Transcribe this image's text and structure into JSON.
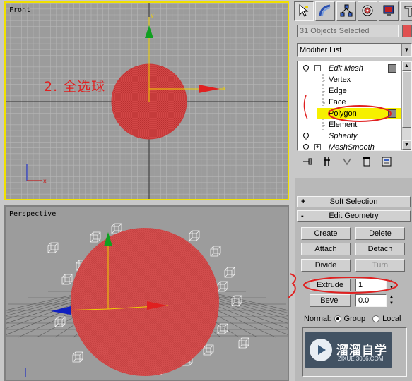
{
  "viewports": {
    "front": {
      "label": "Front"
    },
    "perspective": {
      "label": "Perspective"
    }
  },
  "annotation": {
    "step_text": "2. 全选球"
  },
  "axis_labels": {
    "x": "x",
    "y": "y"
  },
  "panel": {
    "tabs": [
      {
        "icon": "create-icon",
        "active": true
      },
      {
        "icon": "modify-icon",
        "active": false
      },
      {
        "icon": "hierarchy-icon",
        "active": false
      },
      {
        "icon": "motion-icon",
        "active": false
      },
      {
        "icon": "display-icon",
        "active": false
      },
      {
        "icon": "utilities-icon",
        "active": false
      }
    ],
    "selection_text": "31 Objects Selected",
    "modifier_list": "Modifier List",
    "stack": {
      "edit_mesh": "Edit Mesh",
      "vertex": "Vertex",
      "edge": "Edge",
      "face": "Face",
      "polygon": "Polygon",
      "element": "Element",
      "spherify": "Spherify",
      "meshsmooth": "MeshSmooth"
    },
    "rollouts": {
      "soft_selection": "Soft Selection",
      "edit_geometry": "Edit Geometry",
      "soft_sign": "+",
      "edit_sign": "-"
    },
    "buttons": {
      "create": "Create",
      "delete": "Delete",
      "attach": "Attach",
      "detach": "Detach",
      "divide": "Divide",
      "turn": "Turn",
      "extrude": "Extrude",
      "bevel": "Bevel"
    },
    "spinners": {
      "extrude_value": "1",
      "bevel_value": "0.0"
    },
    "normal": {
      "label": "Normal:",
      "group": "Group",
      "local": "Local",
      "selected": "Group"
    }
  },
  "watermark": {
    "title": "溜溜自学",
    "url": "ZIXUE.3066.COM"
  },
  "colors": {
    "viewport_active": "#f0e000",
    "sphere": "#d84040",
    "annotation": "#e02020",
    "highlight": "#f6f000"
  }
}
